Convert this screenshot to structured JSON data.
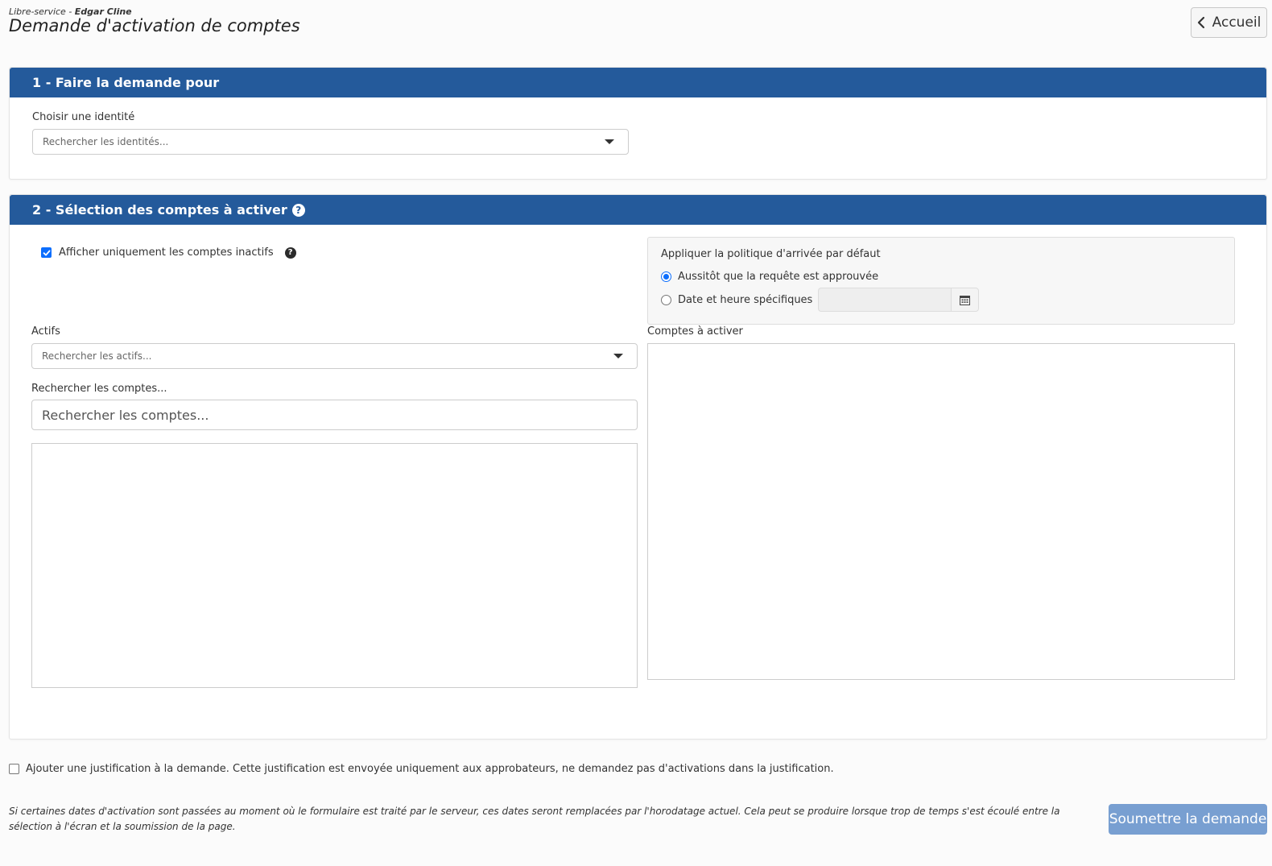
{
  "header": {
    "breadcrumb_prefix": "Libre-service - ",
    "breadcrumb_user": "Edgar Cline",
    "title": "Demande d'activation de comptes",
    "home_label": "Accueil"
  },
  "section1": {
    "title": "1 - Faire la demande pour",
    "identity_label": "Choisir une identité",
    "identity_placeholder": "Rechercher les identités..."
  },
  "section2": {
    "title": "2 - Sélection des comptes à activer",
    "help_glyph": "?",
    "inactive_only_label": "Afficher uniquement les comptes inactifs",
    "inactive_only_checked": true,
    "policy": {
      "title": "Appliquer la politique d'arrivée par défaut",
      "option_immediate": "Aussitôt que la requête est approuvée",
      "option_specific": "Date et heure spécifiques",
      "selected": "immediate"
    },
    "assets_label": "Actifs",
    "assets_placeholder": "Rechercher les actifs...",
    "accounts_search_label": "Rechercher les comptes...",
    "accounts_search_placeholder": "Rechercher les comptes...",
    "accounts_to_activate_label": "Comptes à activer"
  },
  "justification": {
    "label": "Ajouter une justification à la demande. Cette justification est envoyée uniquement aux approbateurs, ne demandez pas d'activations dans la justification.",
    "checked": false
  },
  "footer": {
    "note": "Si certaines dates d'activation sont passées au moment où le formulaire est traité par le serveur, ces dates seront remplacées par l'horodatage actuel. Cela peut se produire lorsque trop de temps s'est écoulé entre la sélection à l'écran et la soumission de la page.",
    "submit_label": "Soumettre la demande"
  },
  "colors": {
    "panel_header": "#245a9b",
    "submit_button": "#789fd1",
    "radio_checked": "#0d6efd"
  }
}
